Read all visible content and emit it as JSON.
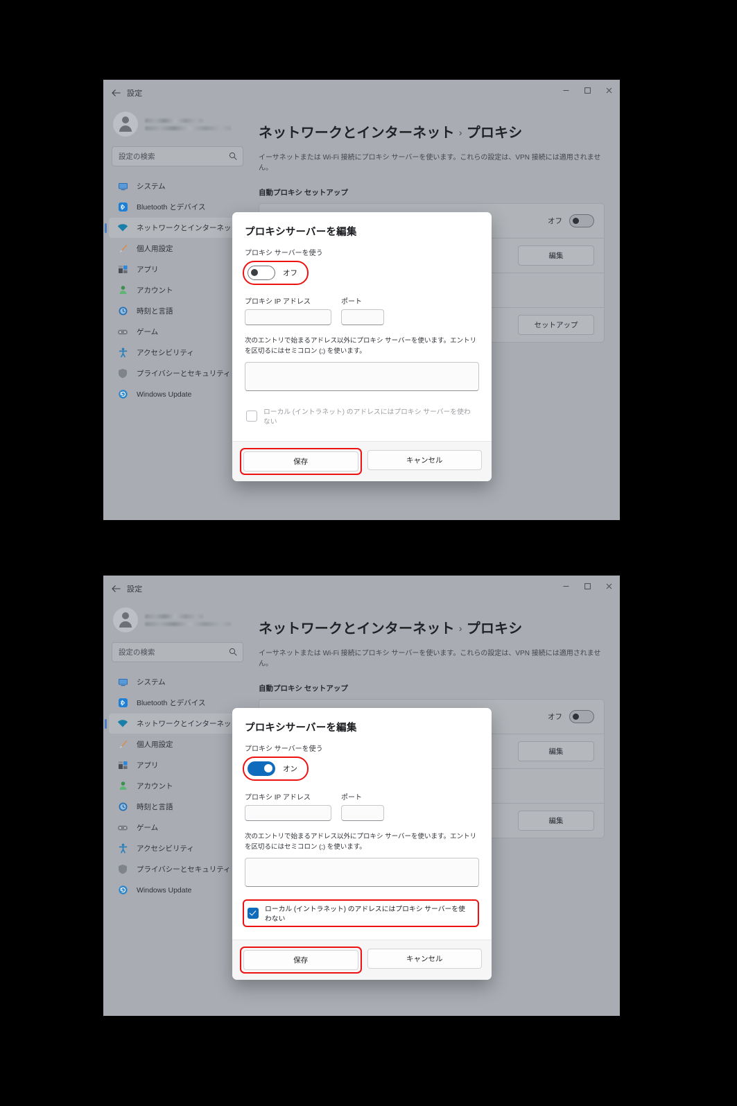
{
  "windows": [
    {
      "titlebar": {
        "back_icon": "back-arrow-icon",
        "title": "設定",
        "minimize": "minimize-icon",
        "maximize": "maximize-icon",
        "close": "close-icon"
      },
      "sidebar": {
        "account": {
          "avatar": "account-avatar",
          "line1_redacted": true,
          "line2_redacted": true
        },
        "search": {
          "placeholder": "設定の検索",
          "icon": "search-icon"
        },
        "items": [
          {
            "label": "システム",
            "icon": "monitor-icon",
            "selected": false
          },
          {
            "label": "Bluetooth とデバイス",
            "icon": "bluetooth-icon",
            "selected": false
          },
          {
            "label": "ネットワークとインターネット",
            "icon": "wifi-icon",
            "selected": true
          },
          {
            "label": "個人用設定",
            "icon": "brush-icon",
            "selected": false
          },
          {
            "label": "アプリ",
            "icon": "apps-icon",
            "selected": false
          },
          {
            "label": "アカウント",
            "icon": "person-icon",
            "selected": false
          },
          {
            "label": "時刻と言語",
            "icon": "clock-globe-icon",
            "selected": false
          },
          {
            "label": "ゲーム",
            "icon": "gamepad-icon",
            "selected": false
          },
          {
            "label": "アクセシビリティ",
            "icon": "accessibility-icon",
            "selected": false
          },
          {
            "label": "プライバシーとセキュリティ",
            "icon": "shield-icon",
            "selected": false
          },
          {
            "label": "Windows Update",
            "icon": "update-icon",
            "selected": false
          }
        ]
      },
      "content": {
        "breadcrumb_parent": "ネットワークとインターネット",
        "breadcrumb_sep": "›",
        "breadcrumb_current": "プロキシ",
        "subtitle": "イーサネットまたは Wi-Fi 接続にプロキシ サーバーを使います。これらの設定は、VPN 接続には適用されません。",
        "section_heading": "自動プロキシ セットアップ",
        "rows": [
          {
            "type": "toggle",
            "state_label": "オフ"
          },
          {
            "type": "button",
            "label": "編集"
          },
          {
            "type": "blank"
          },
          {
            "type": "button",
            "label": "セットアップ"
          }
        ]
      },
      "dialog": {
        "title": "プロキシサーバーを編集",
        "toggle_label": "プロキシ サーバーを使う",
        "toggle_state": "オフ",
        "toggle_on": false,
        "toggle_highlighted": true,
        "ip_label": "プロキシ IP アドレス",
        "ip_value": "",
        "port_label": "ポート",
        "port_value": "",
        "hint": "次のエントリで始まるアドレス以外にプロキシ サーバーを使います。エントリを区切るにはセミコロン (;) を使います。",
        "exceptions_value": "",
        "checkbox_label": "ローカル (イントラネット) のアドレスにはプロキシ サーバーを使わない",
        "checkbox_checked": false,
        "checkbox_highlighted": false,
        "save_label": "保存",
        "save_highlighted": true,
        "cancel_label": "キャンセル"
      }
    },
    {
      "titlebar": {
        "back_icon": "back-arrow-icon",
        "title": "設定",
        "minimize": "minimize-icon",
        "maximize": "maximize-icon",
        "close": "close-icon"
      },
      "sidebar": {
        "account": {
          "avatar": "account-avatar",
          "line1_redacted": true,
          "line2_redacted": true
        },
        "search": {
          "placeholder": "設定の検索",
          "icon": "search-icon"
        },
        "items": [
          {
            "label": "システム",
            "icon": "monitor-icon",
            "selected": false
          },
          {
            "label": "Bluetooth とデバイス",
            "icon": "bluetooth-icon",
            "selected": false
          },
          {
            "label": "ネットワークとインターネット",
            "icon": "wifi-icon",
            "selected": true
          },
          {
            "label": "個人用設定",
            "icon": "brush-icon",
            "selected": false
          },
          {
            "label": "アプリ",
            "icon": "apps-icon",
            "selected": false
          },
          {
            "label": "アカウント",
            "icon": "person-icon",
            "selected": false
          },
          {
            "label": "時刻と言語",
            "icon": "clock-globe-icon",
            "selected": false
          },
          {
            "label": "ゲーム",
            "icon": "gamepad-icon",
            "selected": false
          },
          {
            "label": "アクセシビリティ",
            "icon": "accessibility-icon",
            "selected": false
          },
          {
            "label": "プライバシーとセキュリティ",
            "icon": "shield-icon",
            "selected": false
          },
          {
            "label": "Windows Update",
            "icon": "update-icon",
            "selected": false
          }
        ]
      },
      "content": {
        "breadcrumb_parent": "ネットワークとインターネット",
        "breadcrumb_sep": "›",
        "breadcrumb_current": "プロキシ",
        "subtitle": "イーサネットまたは Wi-Fi 接続にプロキシ サーバーを使います。これらの設定は、VPN 接続には適用されません。",
        "section_heading": "自動プロキシ セットアップ",
        "rows": [
          {
            "type": "toggle",
            "state_label": "オフ"
          },
          {
            "type": "button",
            "label": "編集"
          },
          {
            "type": "blank"
          },
          {
            "type": "button",
            "label": "編集"
          }
        ]
      },
      "dialog": {
        "title": "プロキシサーバーを編集",
        "toggle_label": "プロキシ サーバーを使う",
        "toggle_state": "オン",
        "toggle_on": true,
        "toggle_highlighted": true,
        "ip_label": "プロキシ IP アドレス",
        "ip_value": "",
        "port_label": "ポート",
        "port_value": "",
        "hint": "次のエントリで始まるアドレス以外にプロキシ サーバーを使います。エントリを区切るにはセミコロン (;) を使います。",
        "exceptions_value": "",
        "checkbox_label": "ローカル (イントラネット) のアドレスにはプロキシ サーバーを使わない",
        "checkbox_checked": true,
        "checkbox_highlighted": true,
        "save_label": "保存",
        "save_highlighted": true,
        "cancel_label": "キャンセル"
      }
    }
  ],
  "colors": {
    "accent_blue": "#0f6cbd",
    "highlight_red": "#ee1111",
    "window_chrome": "#a9adb3",
    "dialog_bg": "#ffffff"
  }
}
